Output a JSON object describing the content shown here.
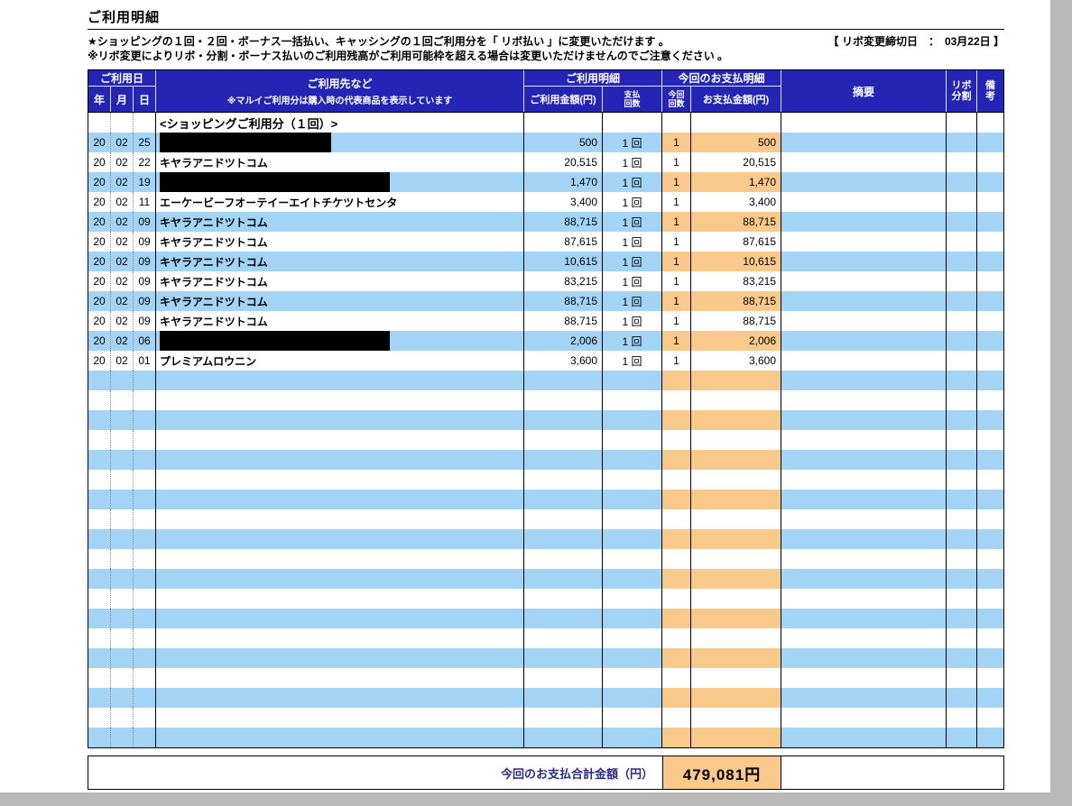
{
  "page": {
    "title": "ご利用明細",
    "notice_line1": "★ショッピングの１回・２回・ボーナス一括払い、キャッシングの１回ご利用分を「 リボ払い 」に変更いただけます 。",
    "revo_deadline": "【 リボ変更締切日　：　03月22日 】",
    "notice_line2": "※リボ変更によりリボ・分割・ボーナス払いのご利用残高がご利用可能枠を超える場合は変更いただけませんのでご注意ください 。"
  },
  "table": {
    "headers": {
      "usage_date": "ご利用日",
      "year": "年",
      "month": "月",
      "day": "日",
      "merchant": "ご利用先など",
      "merchant_note": "※マルイご利用分は購入時の代表商品を表示しています",
      "usage_detail": "ご利用明細",
      "usage_amount": "ご利用金額(円)",
      "pay_count": "支払回数",
      "current_payment_detail": "今回のお支払明細",
      "current_count": "今回回数",
      "payment_amount": "お支払金額(円)",
      "summary": "摘要",
      "revo_split": "リボ分割",
      "remarks": "備考"
    },
    "rows": [
      {
        "type": "section",
        "label": "<ショッピングご利用分（１回）>"
      },
      {
        "type": "data",
        "year": "20",
        "month": "02",
        "day": "25",
        "merchant": "",
        "redacted": true,
        "redact_width": 190,
        "amount": "500",
        "pay_count": "1 回",
        "current_count": "1",
        "payment": "500"
      },
      {
        "type": "data",
        "year": "20",
        "month": "02",
        "day": "22",
        "merchant": "キヤラアニドツトコム",
        "redacted": false,
        "amount": "20,515",
        "pay_count": "1 回",
        "current_count": "1",
        "payment": "20,515"
      },
      {
        "type": "data",
        "year": "20",
        "month": "02",
        "day": "19",
        "merchant": "",
        "redacted": true,
        "redact_width": 255,
        "amount": "1,470",
        "pay_count": "1 回",
        "current_count": "1",
        "payment": "1,470"
      },
      {
        "type": "data",
        "year": "20",
        "month": "02",
        "day": "11",
        "merchant": "エーケービーフオーテイーエイトチケツトセンタ",
        "redacted": false,
        "amount": "3,400",
        "pay_count": "1 回",
        "current_count": "1",
        "payment": "3,400"
      },
      {
        "type": "data",
        "year": "20",
        "month": "02",
        "day": "09",
        "merchant": "キヤラアニドツトコム",
        "redacted": false,
        "amount": "88,715",
        "pay_count": "1 回",
        "current_count": "1",
        "payment": "88,715"
      },
      {
        "type": "data",
        "year": "20",
        "month": "02",
        "day": "09",
        "merchant": "キヤラアニドツトコム",
        "redacted": false,
        "amount": "87,615",
        "pay_count": "1 回",
        "current_count": "1",
        "payment": "87,615"
      },
      {
        "type": "data",
        "year": "20",
        "month": "02",
        "day": "09",
        "merchant": "キヤラアニドツトコム",
        "redacted": false,
        "amount": "10,615",
        "pay_count": "1 回",
        "current_count": "1",
        "payment": "10,615"
      },
      {
        "type": "data",
        "year": "20",
        "month": "02",
        "day": "09",
        "merchant": "キヤラアニドツトコム",
        "redacted": false,
        "amount": "83,215",
        "pay_count": "1 回",
        "current_count": "1",
        "payment": "83,215"
      },
      {
        "type": "data",
        "year": "20",
        "month": "02",
        "day": "09",
        "merchant": "キヤラアニドツトコム",
        "redacted": false,
        "amount": "88,715",
        "pay_count": "1 回",
        "current_count": "1",
        "payment": "88,715"
      },
      {
        "type": "data",
        "year": "20",
        "month": "02",
        "day": "09",
        "merchant": "キヤラアニドツトコム",
        "redacted": false,
        "amount": "88,715",
        "pay_count": "1 回",
        "current_count": "1",
        "payment": "88,715"
      },
      {
        "type": "data",
        "year": "20",
        "month": "02",
        "day": "06",
        "merchant": "",
        "redacted": true,
        "redact_width": 255,
        "amount": "2,006",
        "pay_count": "1 回",
        "current_count": "1",
        "payment": "2,006"
      },
      {
        "type": "data",
        "year": "20",
        "month": "02",
        "day": "01",
        "merchant": "プレミアムロウニン",
        "redacted": false,
        "amount": "3,600",
        "pay_count": "1 回",
        "current_count": "1",
        "payment": "3,600"
      }
    ],
    "empty_row_count": 19
  },
  "footer": {
    "total_label": "今回のお支払合計金額（円）",
    "total_amount": "479,081円"
  },
  "colors": {
    "header_bg": "#2525b5",
    "row_blue": "#a3d4f6",
    "highlight_orange": "#f9c98c"
  }
}
